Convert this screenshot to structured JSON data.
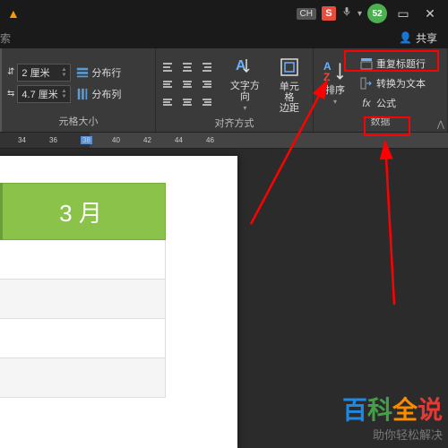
{
  "titlebar": {
    "search_hint": "索",
    "ime_lang": "CH",
    "ime_logo": "S",
    "user_badge": "52"
  },
  "share": {
    "label": "共享"
  },
  "ribbon": {
    "size": {
      "label": "元格大小",
      "height_val": "2 厘米",
      "width_val": "4.7 厘米",
      "dist_rows": "分布行",
      "dist_cols": "分布列"
    },
    "align": {
      "label": "对齐方式",
      "text_dir": "文字方向",
      "cell_margin_l1": "单元格",
      "cell_margin_l2": "边距"
    },
    "sort": {
      "label": "排序"
    },
    "data": {
      "label": "数据",
      "repeat_header": "重复标题行",
      "to_text": "转换为文本",
      "formula": "公式"
    }
  },
  "ruler": {
    "n34": "34",
    "n36": "36",
    "n38": "38",
    "n40": "40",
    "n42": "42",
    "n44": "44",
    "n46": "46"
  },
  "doc": {
    "month": "3 月"
  },
  "watermark": {
    "c1": "百",
    "c2": "科",
    "c3": "全",
    "c4": "说",
    "sub": "助你轻松解决"
  }
}
